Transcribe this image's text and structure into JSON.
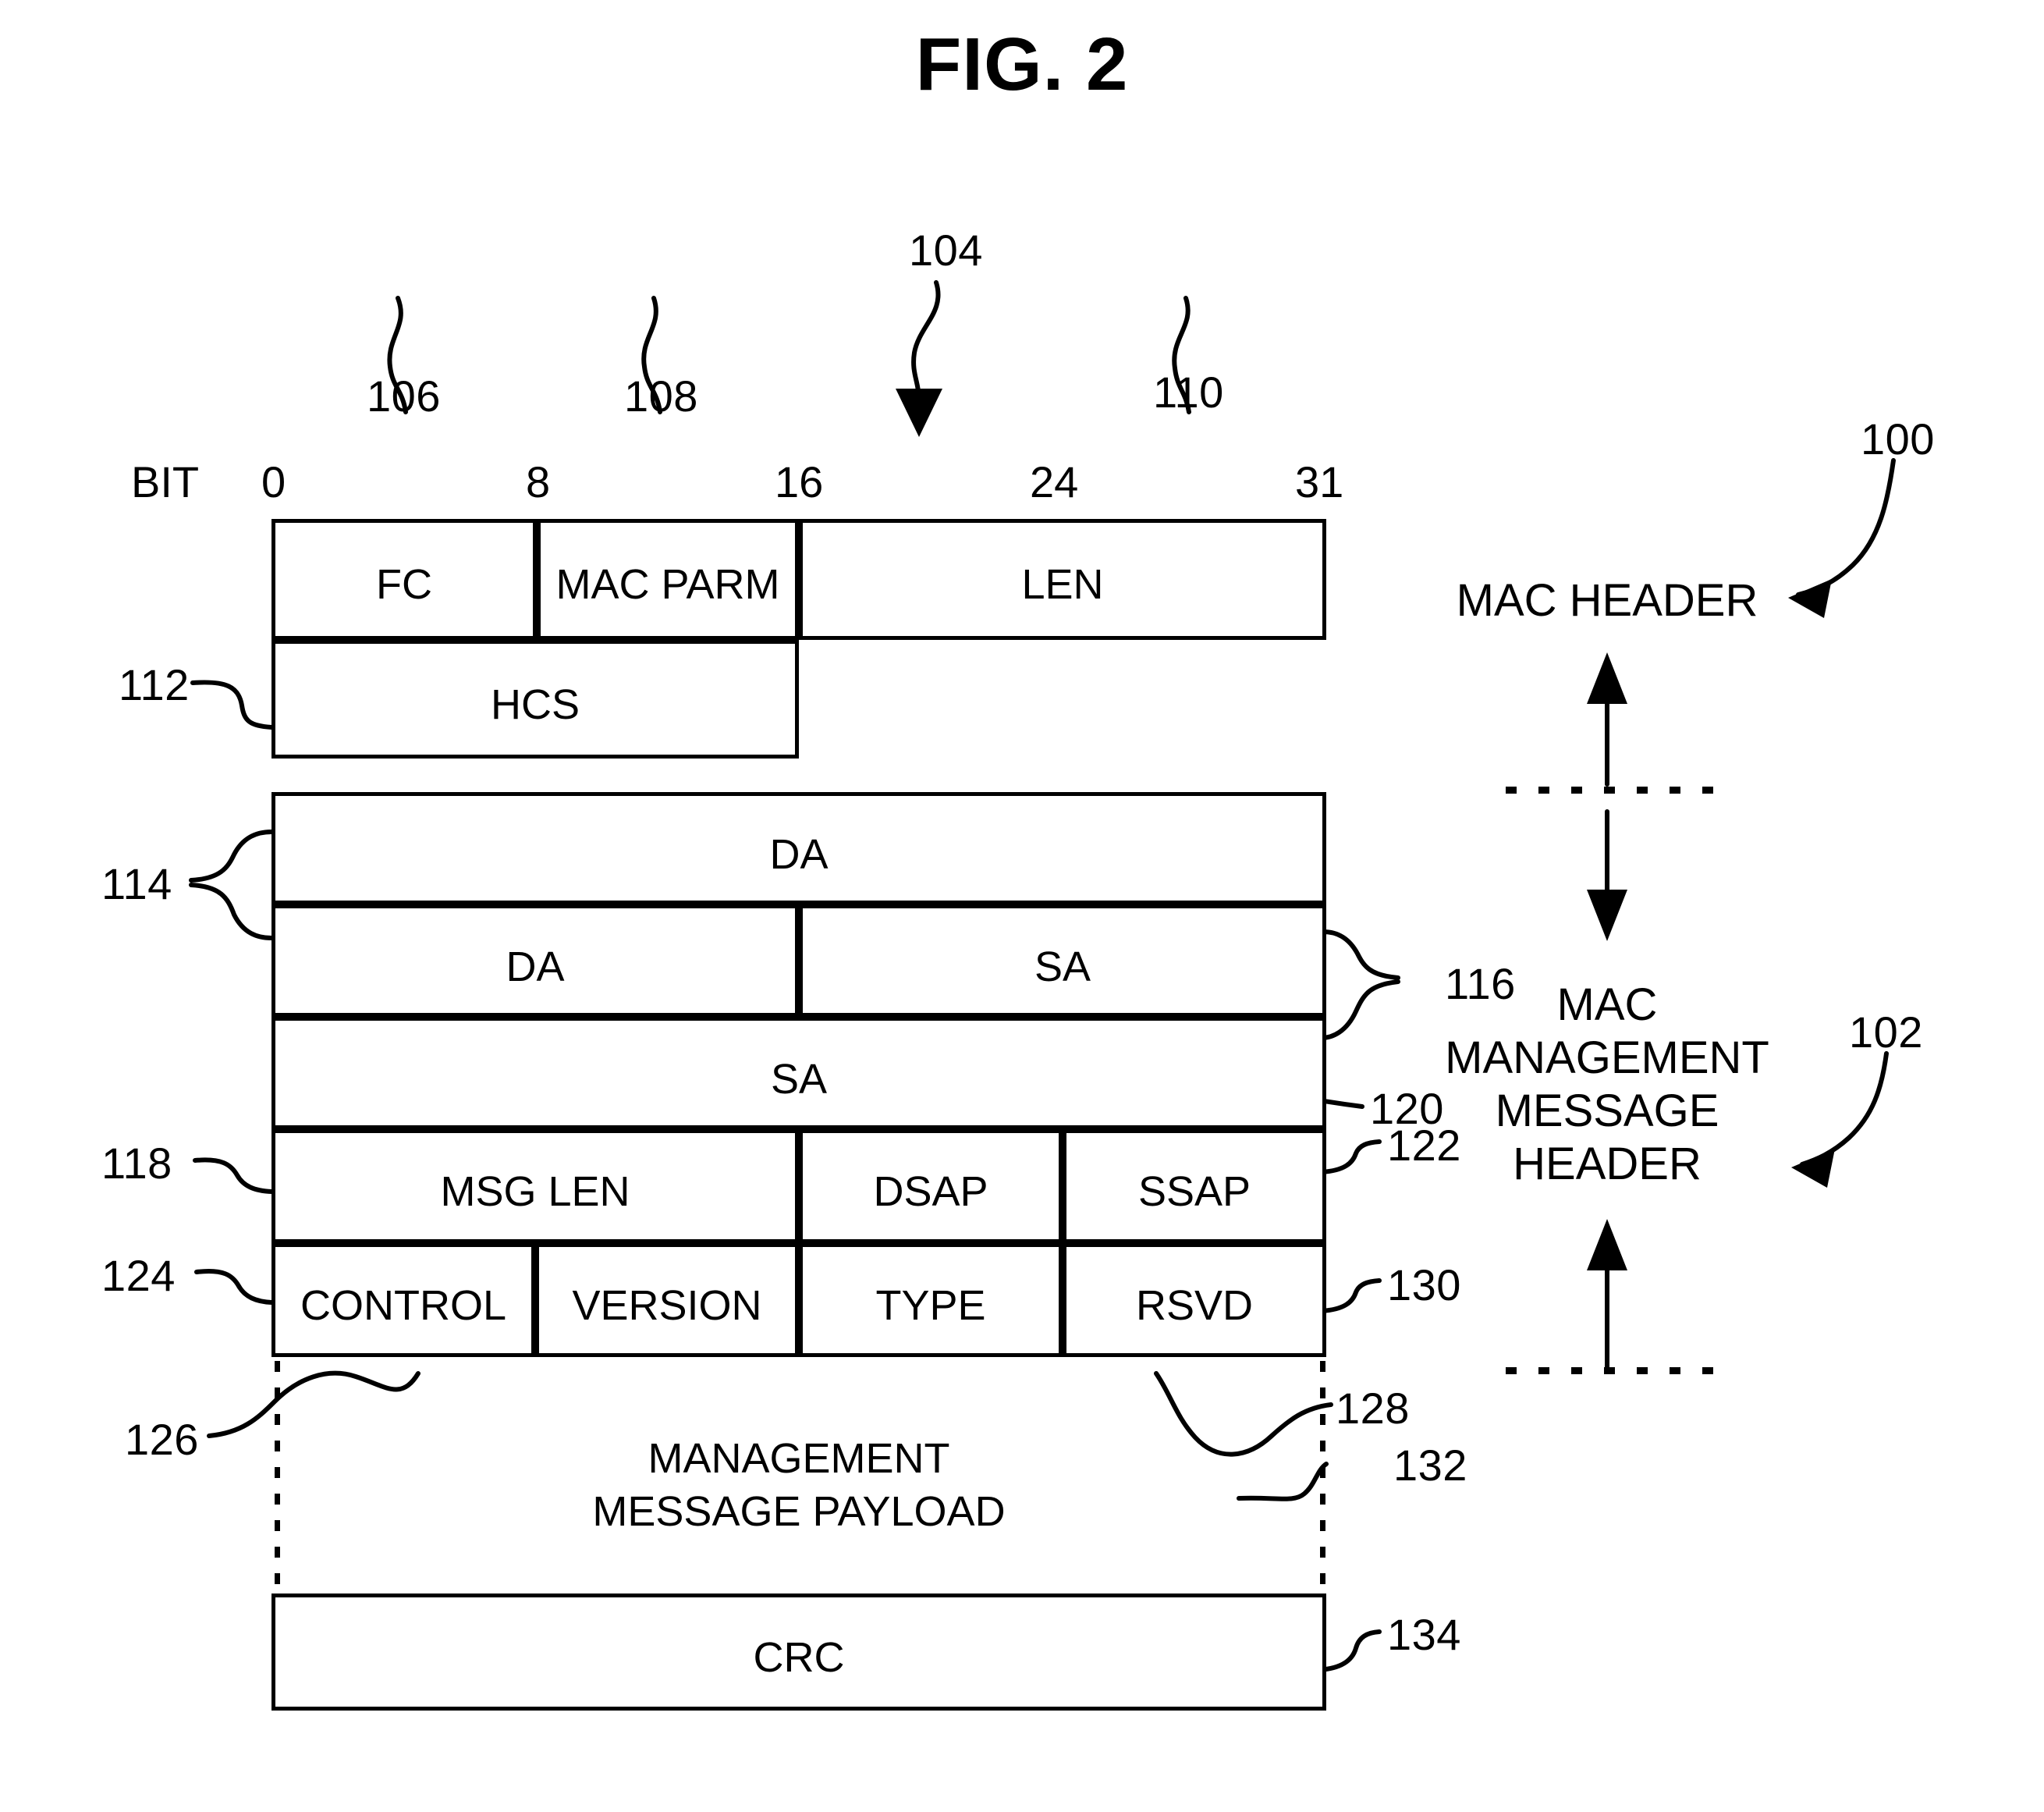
{
  "figure": {
    "title": "FIG. 2"
  },
  "bit_ruler": {
    "label": "BIT",
    "ticks": [
      "0",
      "8",
      "16",
      "24",
      "31"
    ]
  },
  "refs": {
    "r100": "100",
    "r102": "102",
    "r104": "104",
    "r106": "106",
    "r108": "108",
    "r110": "110",
    "r112": "112",
    "r114": "114",
    "r116": "116",
    "r118": "118",
    "r120": "120",
    "r122": "122",
    "r124": "124",
    "r126": "126",
    "r128": "128",
    "r130": "130",
    "r132": "132",
    "r134": "134"
  },
  "mac_header_table": {
    "row1": [
      {
        "label": "FC"
      },
      {
        "label": "MAC PARM"
      },
      {
        "label": "LEN"
      }
    ],
    "row2": [
      {
        "label": "HCS"
      }
    ]
  },
  "mgmt_header_table": {
    "row1": [
      {
        "label": "DA"
      }
    ],
    "row2": [
      {
        "label": "DA"
      },
      {
        "label": "SA"
      }
    ],
    "row3": [
      {
        "label": "SA"
      }
    ],
    "row4": [
      {
        "label": "MSG LEN"
      },
      {
        "label": "DSAP"
      },
      {
        "label": "SSAP"
      }
    ],
    "row5": [
      {
        "label": "CONTROL"
      },
      {
        "label": "VERSION"
      },
      {
        "label": "TYPE"
      },
      {
        "label": "RSVD"
      }
    ]
  },
  "payload": {
    "line1": "MANAGEMENT",
    "line2": "MESSAGE PAYLOAD"
  },
  "crc": {
    "label": "CRC"
  },
  "legend": {
    "mac_header": "MAC HEADER",
    "mgmt_line1": "MAC",
    "mgmt_line2": "MANAGEMENT",
    "mgmt_line3": "MESSAGE",
    "mgmt_line4": "HEADER"
  },
  "colors": {
    "ink": "#000000",
    "paper": "#ffffff"
  }
}
